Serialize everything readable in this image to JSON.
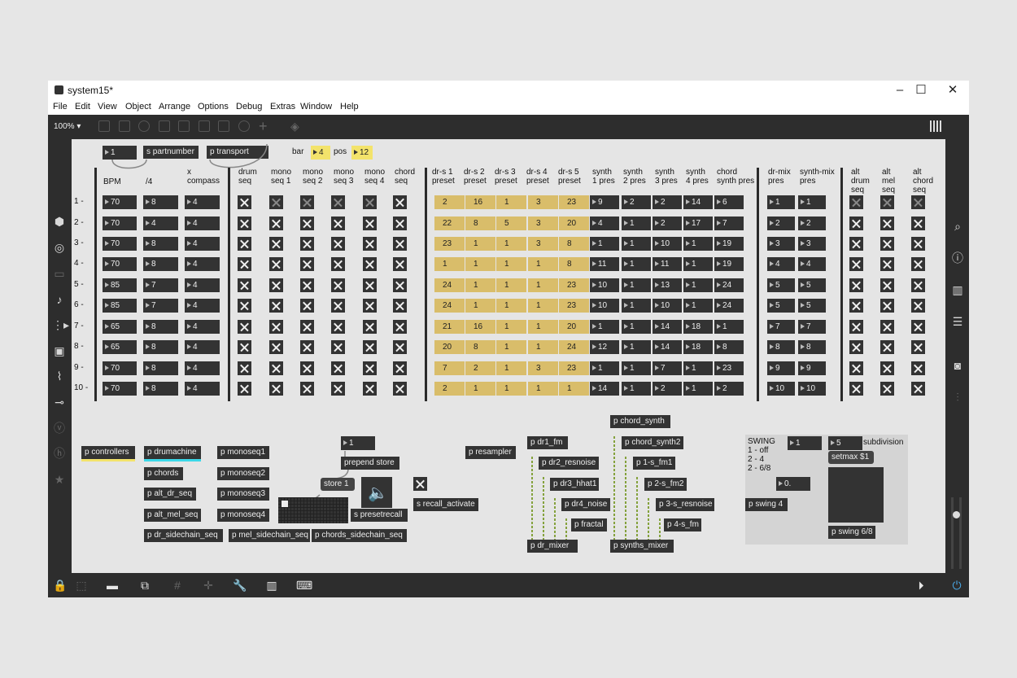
{
  "window": {
    "title": "system15*"
  },
  "menu": [
    "File",
    "Edit",
    "View",
    "Object",
    "Arrange",
    "Options",
    "Debug",
    "Extras",
    "Window",
    "Help"
  ],
  "toolbar": {
    "zoom": "100%"
  },
  "top": {
    "num1": "1",
    "partnumber": "s partnumber",
    "transport": "p transport",
    "bar_label": "bar",
    "bar_value": "4",
    "pos_label": "pos",
    "pos_value": "12"
  },
  "headers": [
    "BPM",
    "/4",
    "x\ncompass",
    "drum\nseq",
    "mono\nseq 1",
    "mono\nseq 2",
    "mono\nseq 3",
    "mono\nseq 4",
    "chord\nseq",
    "dr-s 1\npreset",
    "dr-s 2\npreset",
    "dr-s 3\npreset",
    "dr-s 4\npreset",
    "dr-s 5\npreset",
    "synth\n1 pres",
    "synth\n2 pres",
    "synth\n3 pres",
    "synth\n4 pres",
    "chord\nsynth pres",
    "dr-mix\npres",
    "synth-mix\npres",
    "alt\ndrum\nseq",
    "alt\nmel\nseq",
    "alt\nchord\nseq"
  ],
  "row_labels": [
    "1 -",
    "2 -",
    "3 -",
    "4 -",
    "5 -",
    "6 -",
    "7 -",
    "8 -",
    "9 -",
    "10 -"
  ],
  "bpm": [
    "70",
    "70",
    "70",
    "70",
    "85",
    "85",
    "65",
    "65",
    "70",
    "70"
  ],
  "quarter": [
    "8",
    "4",
    "8",
    "8",
    "7",
    "7",
    "8",
    "8",
    "8",
    "8"
  ],
  "compass": [
    "4",
    "4",
    "4",
    "4",
    "4",
    "4",
    "4",
    "4",
    "4",
    "4"
  ],
  "seq_toggles": [
    [
      1,
      0,
      0,
      0,
      0,
      1
    ],
    [
      1,
      1,
      1,
      1,
      1,
      1
    ],
    [
      1,
      1,
      1,
      1,
      1,
      1
    ],
    [
      1,
      1,
      1,
      1,
      1,
      1
    ],
    [
      1,
      1,
      1,
      1,
      1,
      1
    ],
    [
      1,
      1,
      1,
      1,
      1,
      1
    ],
    [
      1,
      1,
      1,
      1,
      1,
      1
    ],
    [
      1,
      1,
      1,
      1,
      1,
      1
    ],
    [
      1,
      1,
      1,
      1,
      1,
      1
    ],
    [
      1,
      1,
      1,
      1,
      1,
      1
    ]
  ],
  "drs_presets": [
    [
      "2",
      "16",
      "1",
      "3",
      "23"
    ],
    [
      "22",
      "8",
      "5",
      "3",
      "20"
    ],
    [
      "23",
      "1",
      "1",
      "3",
      "8"
    ],
    [
      "1",
      "1",
      "1",
      "1",
      "8"
    ],
    [
      "24",
      "1",
      "1",
      "1",
      "23"
    ],
    [
      "24",
      "1",
      "1",
      "1",
      "23"
    ],
    [
      "21",
      "16",
      "1",
      "1",
      "20"
    ],
    [
      "20",
      "8",
      "1",
      "1",
      "24"
    ],
    [
      "7",
      "2",
      "1",
      "3",
      "23"
    ],
    [
      "2",
      "1",
      "1",
      "1",
      "1"
    ]
  ],
  "synth_presets": [
    [
      "9",
      "2",
      "2",
      "14",
      "6"
    ],
    [
      "4",
      "1",
      "2",
      "17",
      "7"
    ],
    [
      "1",
      "1",
      "10",
      "1",
      "19"
    ],
    [
      "11",
      "1",
      "11",
      "1",
      "19"
    ],
    [
      "10",
      "1",
      "13",
      "1",
      "24"
    ],
    [
      "10",
      "1",
      "10",
      "1",
      "24"
    ],
    [
      "1",
      "1",
      "14",
      "18",
      "1"
    ],
    [
      "12",
      "1",
      "14",
      "18",
      "8"
    ],
    [
      "1",
      "1",
      "7",
      "1",
      "23"
    ],
    [
      "14",
      "1",
      "2",
      "1",
      "2"
    ]
  ],
  "mix_presets": [
    [
      "1",
      "1"
    ],
    [
      "2",
      "2"
    ],
    [
      "3",
      "3"
    ],
    [
      "4",
      "4"
    ],
    [
      "5",
      "5"
    ],
    [
      "5",
      "5"
    ],
    [
      "7",
      "7"
    ],
    [
      "8",
      "8"
    ],
    [
      "9",
      "9"
    ],
    [
      "10",
      "10"
    ]
  ],
  "alt_toggles": [
    [
      0,
      0,
      0
    ],
    [
      1,
      1,
      1
    ],
    [
      1,
      1,
      1
    ],
    [
      1,
      1,
      1
    ],
    [
      1,
      1,
      1
    ],
    [
      1,
      1,
      1
    ],
    [
      1,
      1,
      1
    ],
    [
      1,
      1,
      1
    ],
    [
      1,
      1,
      1
    ],
    [
      1,
      1,
      1
    ]
  ],
  "bottom_objs": {
    "controllers": "p controllers",
    "drumachine": "p drumachine",
    "chords": "p chords",
    "alt_dr_seq": "p alt_dr_seq",
    "alt_mel_seq": "p alt_mel_seq",
    "dr_sidechain_seq": "p dr_sidechain_seq",
    "monoseq1": "p monoseq1",
    "monoseq2": "p monoseq2",
    "monoseq3": "p monoseq3",
    "monoseq4": "p monoseq4",
    "mel_sidechain_seq": "p mel_sidechain_seq",
    "chords_sidechain_seq": "p chords_sidechain_seq",
    "num_one": "1",
    "prepend_store": "prepend store",
    "store1": "store 1",
    "presetrecall": "s presetrecall",
    "recall_activate": "s recall_activate",
    "resampler": "p resampler",
    "dr1_fm": "p dr1_fm",
    "dr2_resnoise": "p dr2_resnoise",
    "dr3_hhat1": "p dr3_hhat1",
    "dr4_noise": "p dr4_noise",
    "fractal": "p fractal",
    "dr_mixer": "p dr_mixer",
    "chord_synth": "p chord_synth",
    "chord_synth2": "p chord_synth2",
    "s1_fm1": "p 1-s_fm1",
    "s2_fm2": "p 2-s_fm2",
    "s3_resnoise": "p 3-s_resnoise",
    "s4_fm": "p 4-s_fm",
    "synths_mixer": "p synths_mixer",
    "swing_label": "SWING\n1 - off\n2 - 4\n2 - 6/8",
    "swing_num": "1",
    "swing_float": "0.",
    "swing4": "p swing 4",
    "subdiv_num": "5",
    "subdiv_label": "subdivision",
    "setmax": "setmax $1",
    "swing68": "p swing 6/8"
  }
}
